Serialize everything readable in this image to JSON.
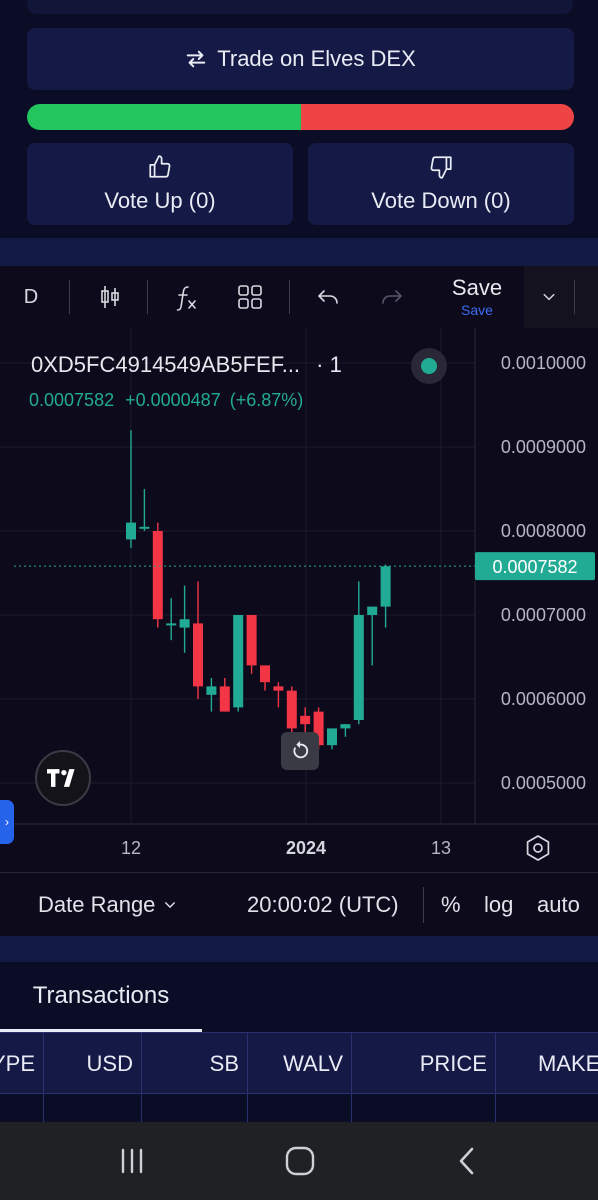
{
  "actions": {
    "trade_label": "Trade on Elves DEX",
    "vote_up_label": "Vote Up (0)",
    "vote_down_label": "Vote Down (0)",
    "vote_up_fraction": 0.5
  },
  "chart_toolbar": {
    "interval": "D",
    "save_label": "Save",
    "save_sublabel": "Save"
  },
  "chart": {
    "symbol": "0XD5FC4914549AB5FEF...",
    "symbol_interval": "· 1",
    "last_price": "0.0007582",
    "change": "+0.0000487",
    "change_pct": "(+6.87%)",
    "current_price_tag": "0.0007582",
    "colors": {
      "up": "#22ab94",
      "down": "#f23645",
      "dotted_line": "#22ab94"
    }
  },
  "chart_data": {
    "type": "candlestick",
    "y_ticks": [
      "0.0010000",
      "0.0009000",
      "0.0008000",
      "0.0007000",
      "0.0006000",
      "0.0005000"
    ],
    "x_ticks": [
      "12",
      "2024",
      "13"
    ],
    "ylim": [
      0.00045,
      0.00102
    ],
    "current_price": 0.0007582,
    "candles": [
      {
        "o": 0.00079,
        "h": 0.00092,
        "l": 0.00078,
        "c": 0.00081
      },
      {
        "o": 0.000805,
        "h": 0.00085,
        "l": 0.0008,
        "c": 0.000805
      },
      {
        "o": 0.0008,
        "h": 0.00081,
        "l": 0.000685,
        "c": 0.000695
      },
      {
        "o": 0.000688,
        "h": 0.00072,
        "l": 0.00067,
        "c": 0.00069
      },
      {
        "o": 0.000685,
        "h": 0.000735,
        "l": 0.000655,
        "c": 0.000695
      },
      {
        "o": 0.00069,
        "h": 0.00074,
        "l": 0.0006,
        "c": 0.000615
      },
      {
        "o": 0.000605,
        "h": 0.000625,
        "l": 0.000585,
        "c": 0.000615
      },
      {
        "o": 0.000615,
        "h": 0.000625,
        "l": 0.00059,
        "c": 0.000585
      },
      {
        "o": 0.00059,
        "h": 0.0007,
        "l": 0.000585,
        "c": 0.0007
      },
      {
        "o": 0.0007,
        "h": 0.0007,
        "l": 0.00063,
        "c": 0.00064
      },
      {
        "o": 0.00064,
        "h": 0.00064,
        "l": 0.00061,
        "c": 0.00062
      },
      {
        "o": 0.000615,
        "h": 0.00062,
        "l": 0.00059,
        "c": 0.00061
      },
      {
        "o": 0.00061,
        "h": 0.000615,
        "l": 0.00056,
        "c": 0.000565
      },
      {
        "o": 0.00058,
        "h": 0.00059,
        "l": 0.00055,
        "c": 0.00057
      },
      {
        "o": 0.000585,
        "h": 0.00059,
        "l": 0.00054,
        "c": 0.000545
      },
      {
        "o": 0.000545,
        "h": 0.000565,
        "l": 0.00054,
        "c": 0.000565
      },
      {
        "o": 0.000565,
        "h": 0.00057,
        "l": 0.000555,
        "c": 0.00057
      },
      {
        "o": 0.000575,
        "h": 0.00074,
        "l": 0.00057,
        "c": 0.0007
      },
      {
        "o": 0.0007,
        "h": 0.00071,
        "l": 0.00064,
        "c": 0.00071
      },
      {
        "o": 0.00071,
        "h": 0.00076,
        "l": 0.000685,
        "c": 0.000758
      }
    ]
  },
  "chart_footer": {
    "date_range_label": "Date Range",
    "time": "20:00:02 (UTC)",
    "percent": "%",
    "log": "log",
    "auto": "auto"
  },
  "transactions": {
    "tab_label": "Transactions",
    "columns": [
      "YPE",
      "USD",
      "SB",
      "WALV",
      "PRICE",
      "MAKE"
    ]
  }
}
